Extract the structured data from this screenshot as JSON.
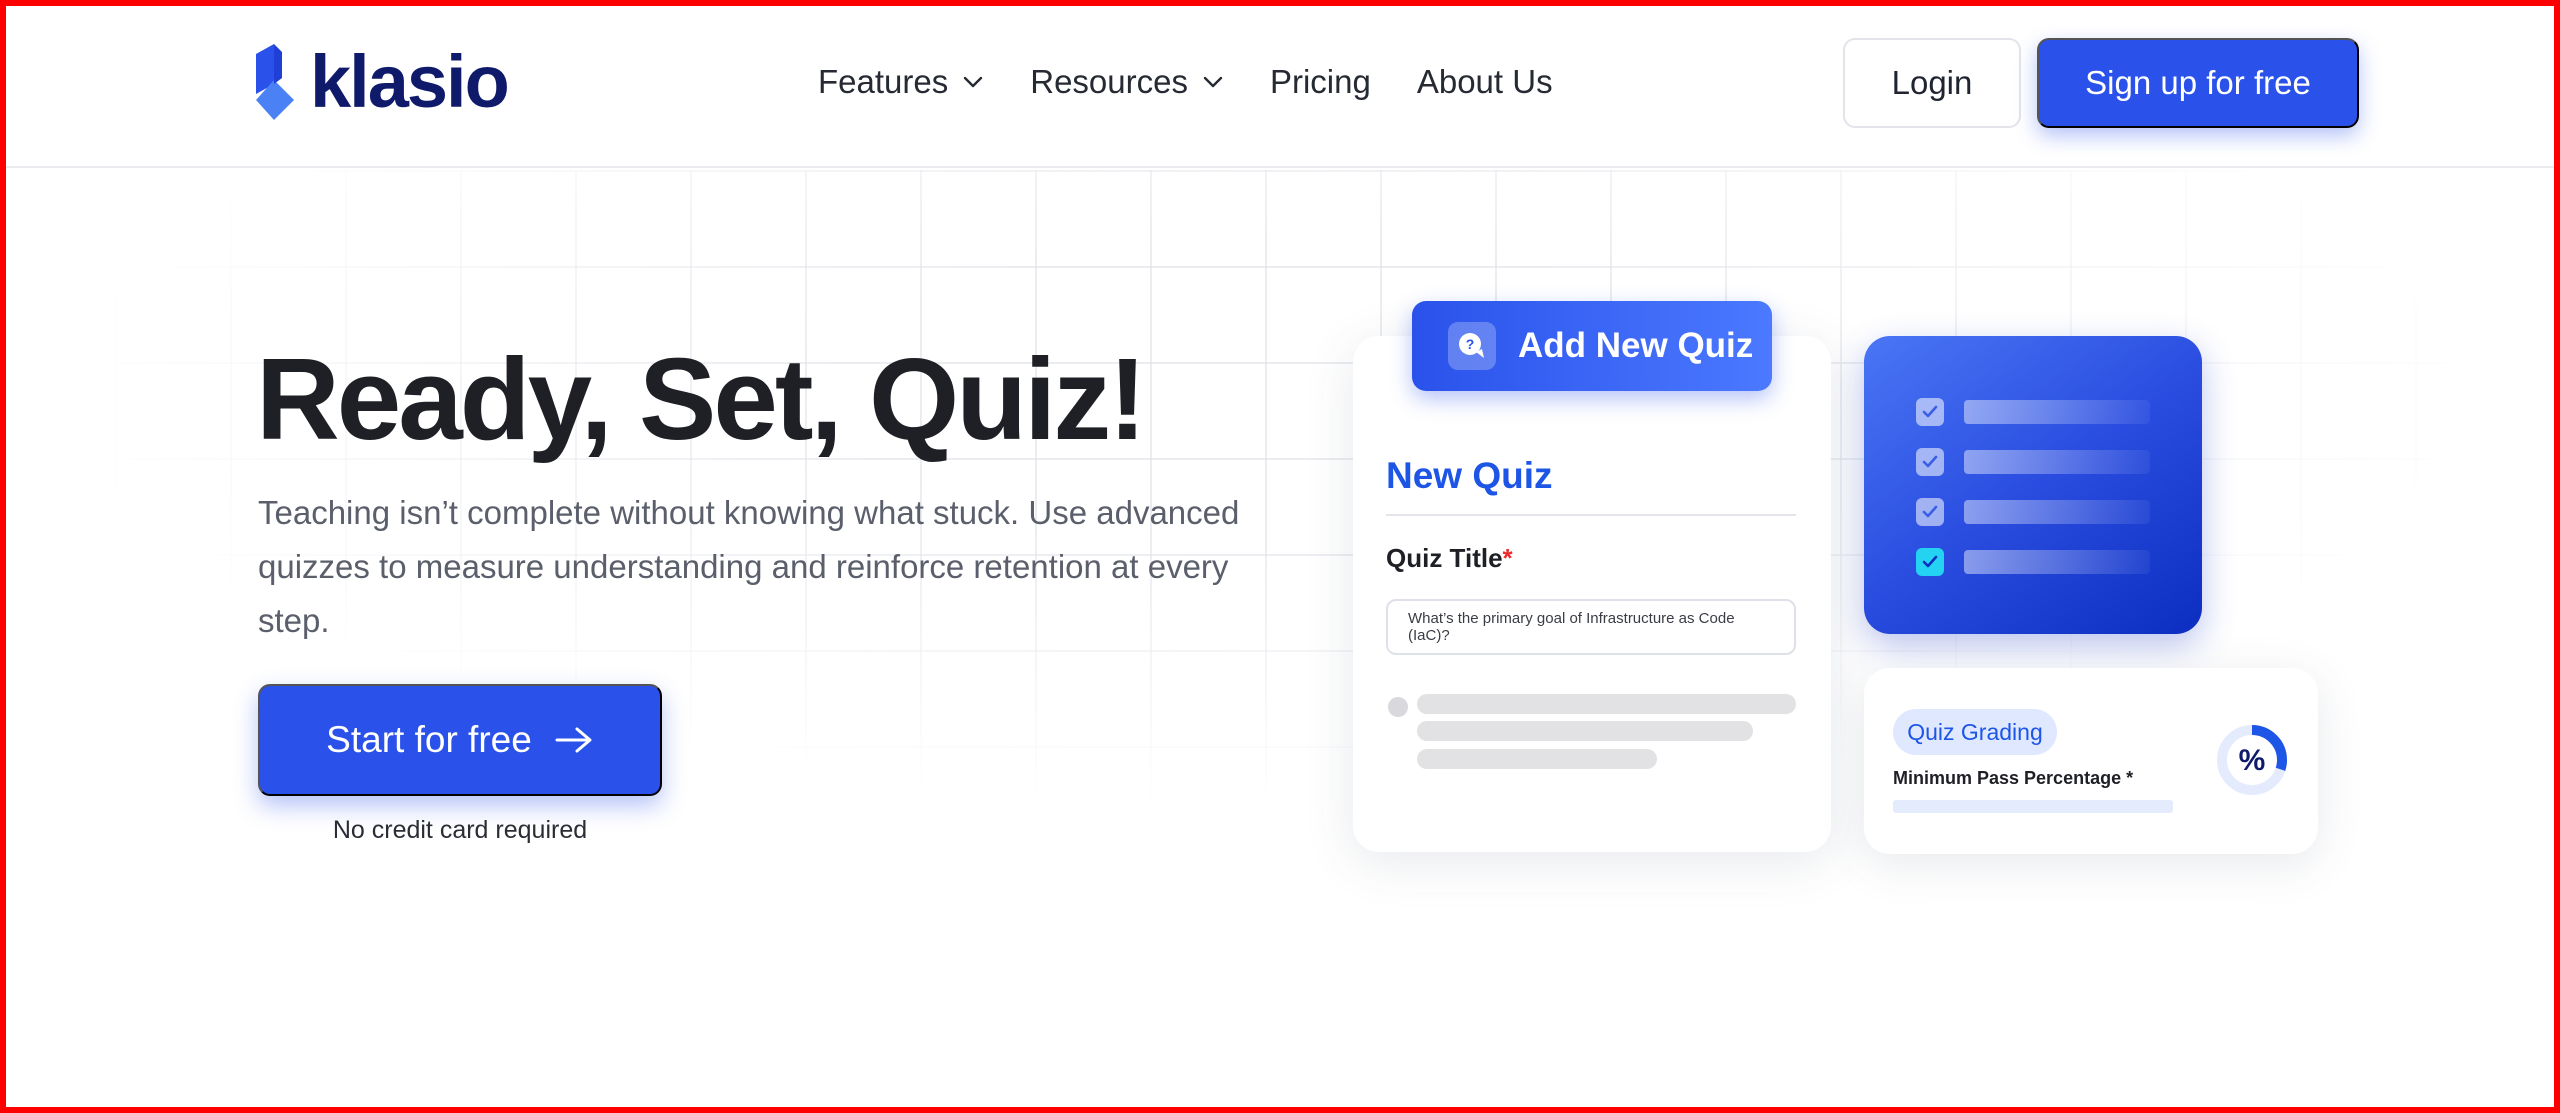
{
  "header": {
    "brand": "klasio",
    "nav": [
      {
        "label": "Features",
        "has_dropdown": true
      },
      {
        "label": "Resources",
        "has_dropdown": true
      },
      {
        "label": "Pricing",
        "has_dropdown": false
      },
      {
        "label": "About Us",
        "has_dropdown": false
      }
    ],
    "login_label": "Login",
    "signup_label": "Sign up for free"
  },
  "hero": {
    "title": "Ready, Set, Quiz!",
    "description": "Teaching isn’t complete without knowing what stuck. Use advanced quizzes to measure understanding and reinforce retention at every step.",
    "cta_label": "Start for free",
    "cta_note": "No credit card required"
  },
  "quiz_card": {
    "badge_label": "Add New Quiz",
    "heading": "New Quiz",
    "title_label": "Quiz Title",
    "required_mark": "*",
    "title_value": "What’s the primary goal of Infrastructure as Code (IaC)?"
  },
  "checklist_card": {
    "items": [
      {
        "checked": true,
        "highlighted": false
      },
      {
        "checked": true,
        "highlighted": false
      },
      {
        "checked": true,
        "highlighted": false
      },
      {
        "checked": true,
        "highlighted": true
      }
    ]
  },
  "grading_card": {
    "pill_label": "Quiz Grading",
    "field_label": "Minimum Pass Percentage *",
    "donut_symbol": "%",
    "donut_fill_fraction": 0.3
  },
  "colors": {
    "brand_blue": "#2a52eb",
    "logo_navy": "#0f1a6b",
    "accent_cyan": "#24d3f2",
    "required_red": "#ef2a2a"
  }
}
